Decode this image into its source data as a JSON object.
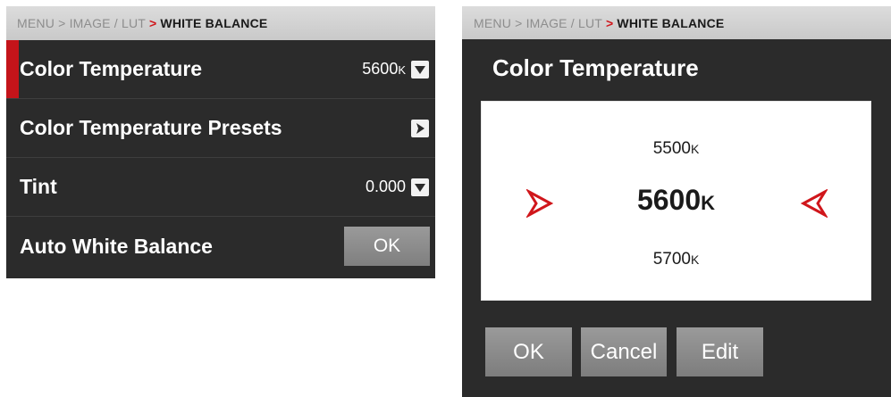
{
  "left_panel": {
    "breadcrumb": {
      "path": "MENU > IMAGE / LUT",
      "arrow": ">",
      "current": "WHITE BALANCE"
    },
    "rows": [
      {
        "label": "Color Temperature",
        "value": "5600",
        "unit": "K",
        "control": "dropdown-icon",
        "selected": true
      },
      {
        "label": "Color Temperature Presets",
        "control": "chevron-right-icon"
      },
      {
        "label": "Tint",
        "value": "0.000",
        "control": "dropdown-icon"
      },
      {
        "label": "Auto White Balance",
        "button_label": "OK"
      }
    ]
  },
  "right_panel": {
    "breadcrumb": {
      "path": "MENU > IMAGE / LUT",
      "arrow": ">",
      "current": "WHITE BALANCE"
    },
    "title": "Color Temperature",
    "picker": {
      "previous": "5500",
      "current": "5600",
      "next": "5700",
      "unit": "K",
      "left_arrow_icon": "chevron-right-icon",
      "right_arrow_icon": "chevron-left-icon"
    },
    "buttons": {
      "ok": "OK",
      "cancel": "Cancel",
      "edit": "Edit"
    }
  },
  "colors": {
    "accent_red": "#c4141a",
    "panel_bg": "#2b2b2b",
    "button_gray": "#8c8c8c"
  }
}
